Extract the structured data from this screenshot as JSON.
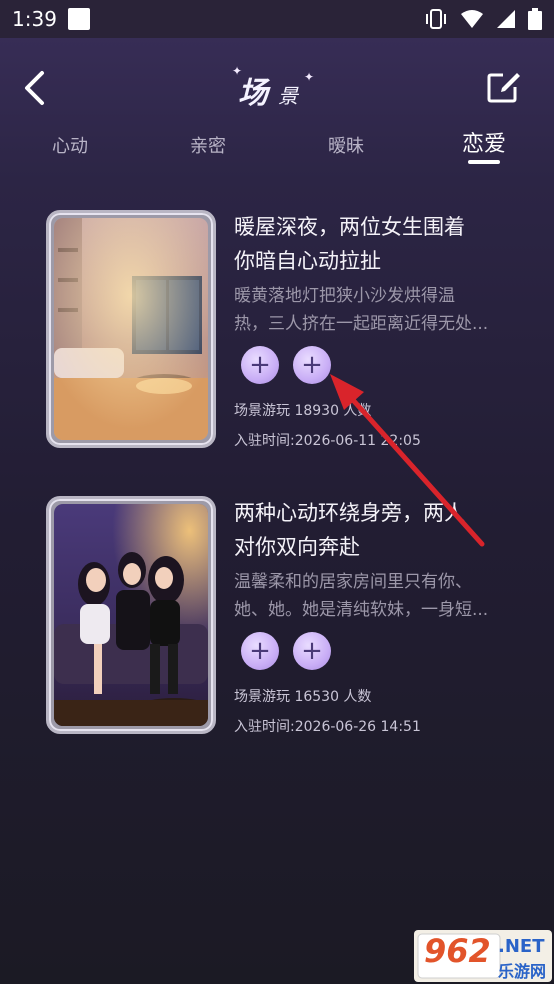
{
  "status_bar": {
    "time": "1:39"
  },
  "header": {
    "title_main": "场",
    "title_sub": "景",
    "back_icon": "chevron-left-icon",
    "edit_icon": "edit-square-icon"
  },
  "tabs": [
    {
      "label": "心动",
      "active": false
    },
    {
      "label": "亲密",
      "active": false
    },
    {
      "label": "暧昧",
      "active": false
    },
    {
      "label": "恋爱",
      "active": true
    }
  ],
  "cards": [
    {
      "title_line1": "暖屋深夜，两位女生围着",
      "title_line2": "你暗自心动拉扯",
      "desc_line1": "暖黄落地灯把狭小沙发烘得温",
      "desc_line2": "热，三人挤在一起距离近得无处...",
      "plays": "场景游玩 18930 人数",
      "joined": "入驻时间:2026-06-11 22:05",
      "plus_label": "+"
    },
    {
      "title_line1": "两种心动环绕身旁，两人",
      "title_line2": "对你双向奔赴",
      "desc_line1": "温馨柔和的居家房间里只有你、",
      "desc_line2": "她、她。她是清纯软妹，一身短...",
      "plays": "场景游玩 16530 人数",
      "joined": "入驻时间:2026-06-26 14:51",
      "plus_label": "+"
    }
  ],
  "watermark": {
    "brand": "962",
    "suffix": ".NET",
    "sub": "乐游网"
  },
  "colors": {
    "accent": "#c9aef6",
    "arrow": "#d9242b",
    "background": "#221d33"
  }
}
